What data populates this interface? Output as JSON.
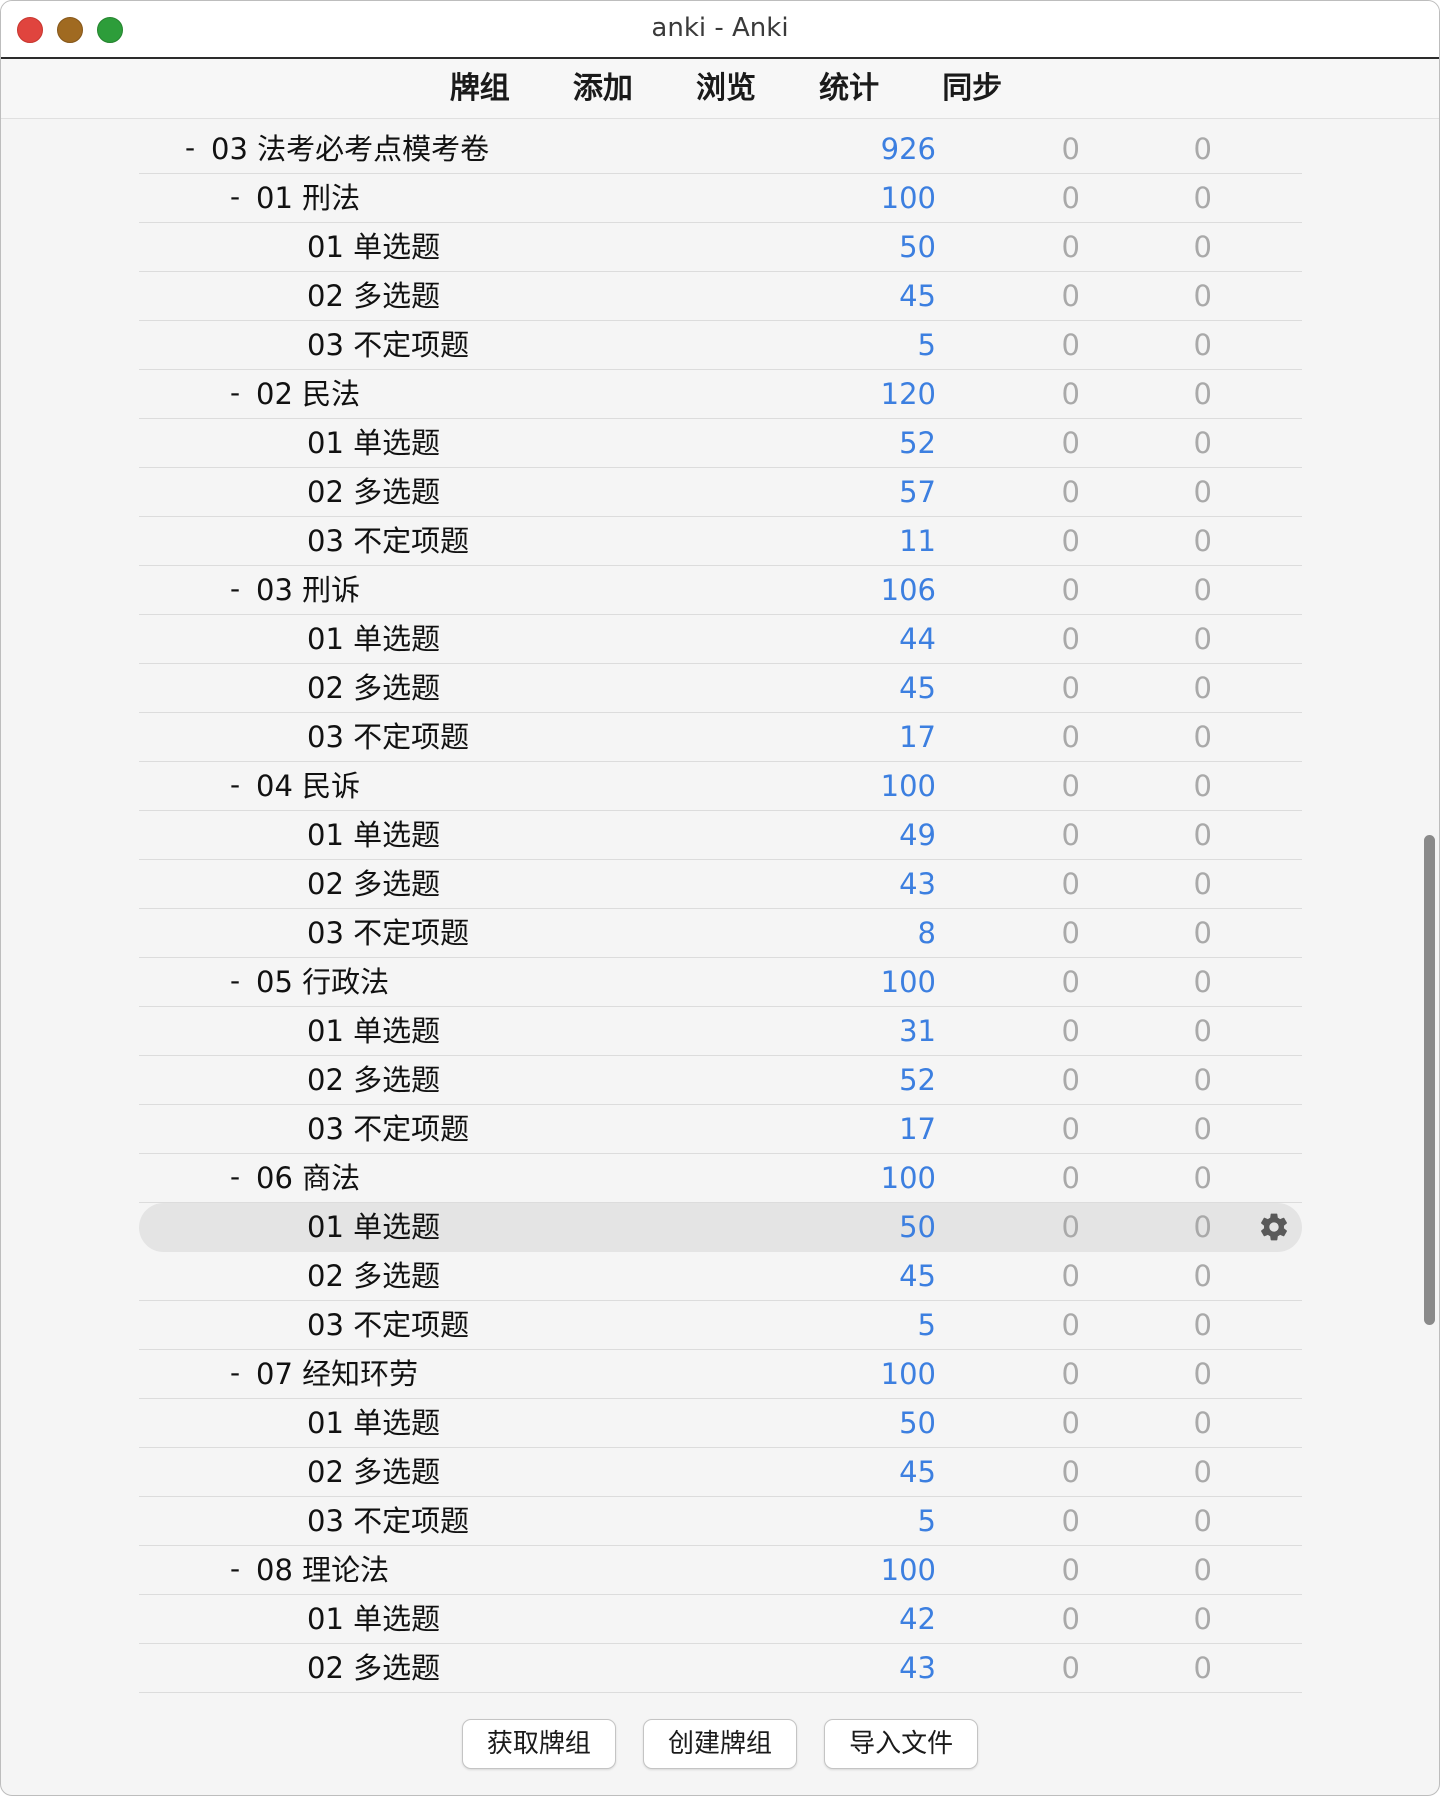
{
  "window": {
    "title": "anki - Anki"
  },
  "toolbar": {
    "items": [
      "牌组",
      "添加",
      "浏览",
      "统计",
      "同步"
    ]
  },
  "decks": [
    {
      "name": "03 法考必考点模考卷",
      "level": 0,
      "collapse": "-",
      "new": "926",
      "learn": "0",
      "due": "0"
    },
    {
      "name": "01 刑法",
      "level": 1,
      "collapse": "-",
      "new": "100",
      "learn": "0",
      "due": "0"
    },
    {
      "name": "01 单选题",
      "level": 2,
      "collapse": "",
      "new": "50",
      "learn": "0",
      "due": "0"
    },
    {
      "name": "02 多选题",
      "level": 2,
      "collapse": "",
      "new": "45",
      "learn": "0",
      "due": "0"
    },
    {
      "name": "03 不定项题",
      "level": 2,
      "collapse": "",
      "new": "5",
      "learn": "0",
      "due": "0"
    },
    {
      "name": "02 民法",
      "level": 1,
      "collapse": "-",
      "new": "120",
      "learn": "0",
      "due": "0"
    },
    {
      "name": "01 单选题",
      "level": 2,
      "collapse": "",
      "new": "52",
      "learn": "0",
      "due": "0"
    },
    {
      "name": "02 多选题",
      "level": 2,
      "collapse": "",
      "new": "57",
      "learn": "0",
      "due": "0"
    },
    {
      "name": "03 不定项题",
      "level": 2,
      "collapse": "",
      "new": "11",
      "learn": "0",
      "due": "0"
    },
    {
      "name": "03 刑诉",
      "level": 1,
      "collapse": "-",
      "new": "106",
      "learn": "0",
      "due": "0"
    },
    {
      "name": "01 单选题",
      "level": 2,
      "collapse": "",
      "new": "44",
      "learn": "0",
      "due": "0"
    },
    {
      "name": "02 多选题",
      "level": 2,
      "collapse": "",
      "new": "45",
      "learn": "0",
      "due": "0"
    },
    {
      "name": "03 不定项题",
      "level": 2,
      "collapse": "",
      "new": "17",
      "learn": "0",
      "due": "0"
    },
    {
      "name": "04 民诉",
      "level": 1,
      "collapse": "-",
      "new": "100",
      "learn": "0",
      "due": "0"
    },
    {
      "name": "01 单选题",
      "level": 2,
      "collapse": "",
      "new": "49",
      "learn": "0",
      "due": "0"
    },
    {
      "name": "02 多选题",
      "level": 2,
      "collapse": "",
      "new": "43",
      "learn": "0",
      "due": "0"
    },
    {
      "name": "03 不定项题",
      "level": 2,
      "collapse": "",
      "new": "8",
      "learn": "0",
      "due": "0"
    },
    {
      "name": "05 行政法",
      "level": 1,
      "collapse": "-",
      "new": "100",
      "learn": "0",
      "due": "0"
    },
    {
      "name": "01 单选题",
      "level": 2,
      "collapse": "",
      "new": "31",
      "learn": "0",
      "due": "0"
    },
    {
      "name": "02 多选题",
      "level": 2,
      "collapse": "",
      "new": "52",
      "learn": "0",
      "due": "0"
    },
    {
      "name": "03 不定项题",
      "level": 2,
      "collapse": "",
      "new": "17",
      "learn": "0",
      "due": "0"
    },
    {
      "name": "06 商法",
      "level": 1,
      "collapse": "-",
      "new": "100",
      "learn": "0",
      "due": "0"
    },
    {
      "name": "01 单选题",
      "level": 2,
      "collapse": "",
      "new": "50",
      "learn": "0",
      "due": "0",
      "selected": true,
      "icon": "gear-icon"
    },
    {
      "name": "02 多选题",
      "level": 2,
      "collapse": "",
      "new": "45",
      "learn": "0",
      "due": "0"
    },
    {
      "name": "03 不定项题",
      "level": 2,
      "collapse": "",
      "new": "5",
      "learn": "0",
      "due": "0"
    },
    {
      "name": "07 经知环劳",
      "level": 1,
      "collapse": "-",
      "new": "100",
      "learn": "0",
      "due": "0"
    },
    {
      "name": "01 单选题",
      "level": 2,
      "collapse": "",
      "new": "50",
      "learn": "0",
      "due": "0"
    },
    {
      "name": "02 多选题",
      "level": 2,
      "collapse": "",
      "new": "45",
      "learn": "0",
      "due": "0"
    },
    {
      "name": "03 不定项题",
      "level": 2,
      "collapse": "",
      "new": "5",
      "learn": "0",
      "due": "0"
    },
    {
      "name": "08 理论法",
      "level": 1,
      "collapse": "-",
      "new": "100",
      "learn": "0",
      "due": "0"
    },
    {
      "name": "01 单选题",
      "level": 2,
      "collapse": "",
      "new": "42",
      "learn": "0",
      "due": "0"
    },
    {
      "name": "02 多选题",
      "level": 2,
      "collapse": "",
      "new": "43",
      "learn": "0",
      "due": "0"
    }
  ],
  "buttons": {
    "get_shared": "获取牌组",
    "create_deck": "创建牌组",
    "import_file": "导入文件"
  },
  "colors": {
    "new_count": "#3c7fe0",
    "zero_count": "#a9a9a9",
    "selected_row": "#e4e4e4"
  }
}
